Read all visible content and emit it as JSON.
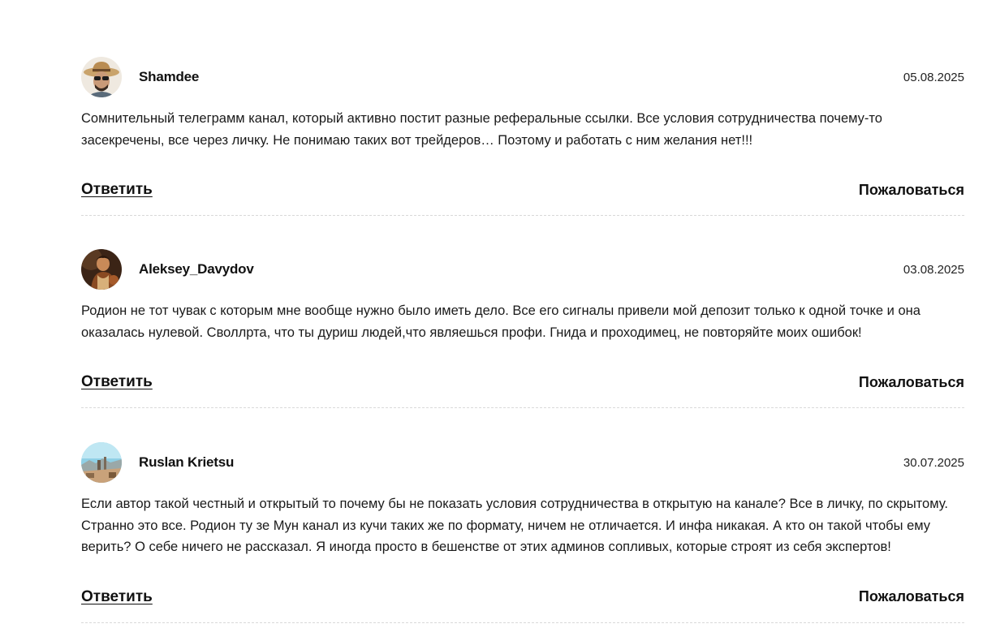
{
  "comments": [
    {
      "author": "Shamdee",
      "date": "05.08.2025",
      "text": "Сомнительный телеграмм канал, который активно постит разные реферальные ссылки. Все условия сотрудничества почему-то засекречены, все через личку. Не понимаю таких вот трейдеров… Поэтому и работать с ним желания нет!!!",
      "reply_label": "Ответить",
      "report_label": "Пожаловаться",
      "avatar_icon": "avatar-man-straw-hat"
    },
    {
      "author": "Aleksey_Davydov",
      "date": "03.08.2025",
      "text": "Родион не тот чувак с которым мне вообще нужно было иметь дело. Все его сигналы привели мой депозит только к одной точке и она оказалась нулевой. Своллрта, что ты дуриш людей,что являешься профи. Гнида и проходимец, не повторяйте моих ошибок!",
      "reply_label": "Ответить",
      "report_label": "Пожаловаться",
      "avatar_icon": "avatar-painting-portrait"
    },
    {
      "author": "Ruslan Krietsu",
      "date": "30.07.2025",
      "text": "Если автор такой честный и открытый то почему бы не показать условия сотрудничества в открытую на канале? Все в личку, по скрытому. Странно это все. Родион ту зе Мун канал из кучи таких же по формату, ничем не отличается. И инфа никакая. А кто он такой чтобы ему верить? О себе ничего не рассказал. Я иногда просто в бешенстве от этих админов сопливых, которые строят из себя экспертов!",
      "reply_label": "Ответить",
      "report_label": "Пожаловаться",
      "avatar_icon": "avatar-landscape-photo"
    }
  ]
}
